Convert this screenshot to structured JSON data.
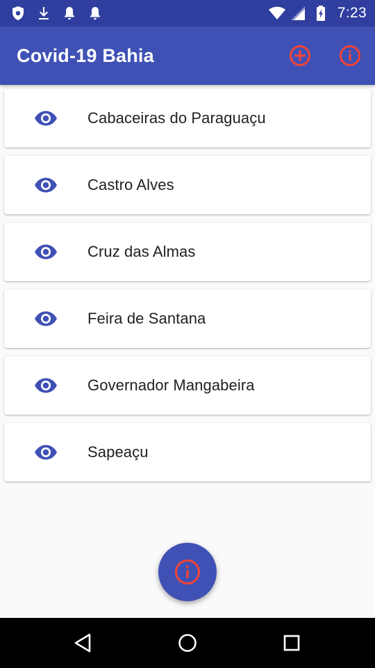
{
  "status_bar": {
    "time": "7:23",
    "left_icons": [
      "shield-icon",
      "download-icon",
      "notification-bell-icon",
      "notification-bell-icon"
    ],
    "right_icons": [
      "wifi-icon",
      "cellular-signal-icon",
      "battery-icon"
    ]
  },
  "app_bar": {
    "title": "Covid-19 Bahia",
    "actions": [
      "add-circle-icon",
      "info-icon"
    ]
  },
  "cities": [
    {
      "name": "Cabaceiras do Paraguaçu",
      "icon": "eye-icon"
    },
    {
      "name": "Castro Alves",
      "icon": "eye-icon"
    },
    {
      "name": "Cruz das Almas",
      "icon": "eye-icon"
    },
    {
      "name": "Feira de Santana",
      "icon": "eye-icon"
    },
    {
      "name": "Governador Mangabeira",
      "icon": "eye-icon"
    },
    {
      "name": "Sapeaçu",
      "icon": "eye-icon"
    }
  ],
  "fab": {
    "icon": "info-icon"
  },
  "nav_bar": {
    "buttons": [
      "back-icon",
      "home-icon",
      "recents-icon"
    ]
  },
  "colors": {
    "primary": "#3f51b5",
    "primary_dark": "#303f9f",
    "accent": "#f44336",
    "eye": "#3f51b5",
    "background": "#fafafa",
    "text": "#212121"
  }
}
